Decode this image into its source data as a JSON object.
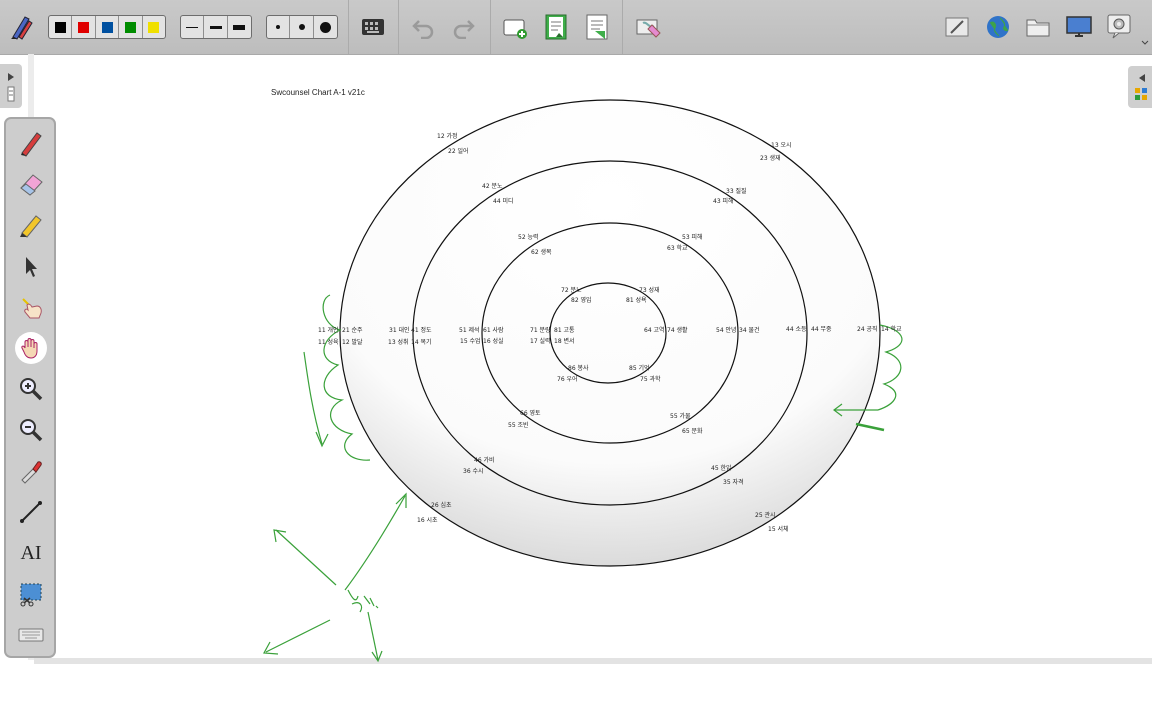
{
  "toolbar": {
    "pen_colors": [
      "#000000",
      "#e00000",
      "#0050a0",
      "#008c00",
      "#f0e000"
    ],
    "line_widths": [
      "thin",
      "medium",
      "thick"
    ],
    "dot_sizes": [
      "small",
      "medium",
      "large"
    ],
    "icons": [
      "pen-settings-icon",
      "keyboard-icon",
      "undo-icon",
      "redo-icon",
      "add-page-icon",
      "previous-page-icon",
      "next-page-icon",
      "clear-icon",
      "whiteboard-icon",
      "globe-icon",
      "folder-icon",
      "display-icon",
      "settings-icon"
    ]
  },
  "left_tools": [
    "pen-icon",
    "eraser-icon",
    "highlighter-icon",
    "select-arrow-icon",
    "pointer-hand-icon",
    "pan-hand-icon",
    "zoom-in-icon",
    "zoom-out-icon",
    "eyedropper-icon",
    "line-icon",
    "text-icon",
    "screen-capture-icon",
    "keyboard-icon"
  ],
  "left_tools_text": {
    "text_tool": "AI"
  },
  "board": {
    "title": "Swcounsel Chart A-1 v21c",
    "labels": [
      {
        "t": "12 가정"
      },
      {
        "t": "22 일어"
      },
      {
        "t": "13 오시"
      },
      {
        "t": "23 생재"
      },
      {
        "t": "42 분노"
      },
      {
        "t": "44 미디"
      },
      {
        "t": "33 질질"
      },
      {
        "t": "43 피해"
      },
      {
        "t": "52 능력"
      },
      {
        "t": "62 생복"
      },
      {
        "t": "53 피해"
      },
      {
        "t": "63 학교"
      },
      {
        "t": "72 분노"
      },
      {
        "t": "82 영입"
      },
      {
        "t": "73 성재"
      },
      {
        "t": "81 성욕"
      },
      {
        "t": "11 개인"
      },
      {
        "t": "21 순주"
      },
      {
        "t": "31 대인"
      },
      {
        "t": "41 정도"
      },
      {
        "t": "51 제석"
      },
      {
        "t": "61 사람"
      },
      {
        "t": "71 분량"
      },
      {
        "t": "81 고통"
      },
      {
        "t": "64 고역"
      },
      {
        "t": "74 생활"
      },
      {
        "t": "54 안녕"
      },
      {
        "t": "34 물건"
      },
      {
        "t": "44 소등"
      },
      {
        "t": "44 무중"
      },
      {
        "t": "24 공직"
      },
      {
        "t": "14 학교"
      },
      {
        "t": "11 성육"
      },
      {
        "t": "12 발달"
      },
      {
        "t": "13 성취"
      },
      {
        "t": "14 복기"
      },
      {
        "t": "15 수업"
      },
      {
        "t": "16 성실"
      },
      {
        "t": "17 실력"
      },
      {
        "t": "18 변서"
      },
      {
        "t": "86 봉사"
      },
      {
        "t": "76 우어"
      },
      {
        "t": "85 기억"
      },
      {
        "t": "75 과학"
      },
      {
        "t": "66 영토"
      },
      {
        "t": "55 조빈"
      },
      {
        "t": "55 가물"
      },
      {
        "t": "65 문화"
      },
      {
        "t": "46 가비"
      },
      {
        "t": "36 수시"
      },
      {
        "t": "45 한입"
      },
      {
        "t": "35 자격"
      },
      {
        "t": "26 심초"
      },
      {
        "t": "16 시초"
      },
      {
        "t": "25 관시"
      },
      {
        "t": "15 서체"
      }
    ],
    "handwriting": "유역."
  }
}
